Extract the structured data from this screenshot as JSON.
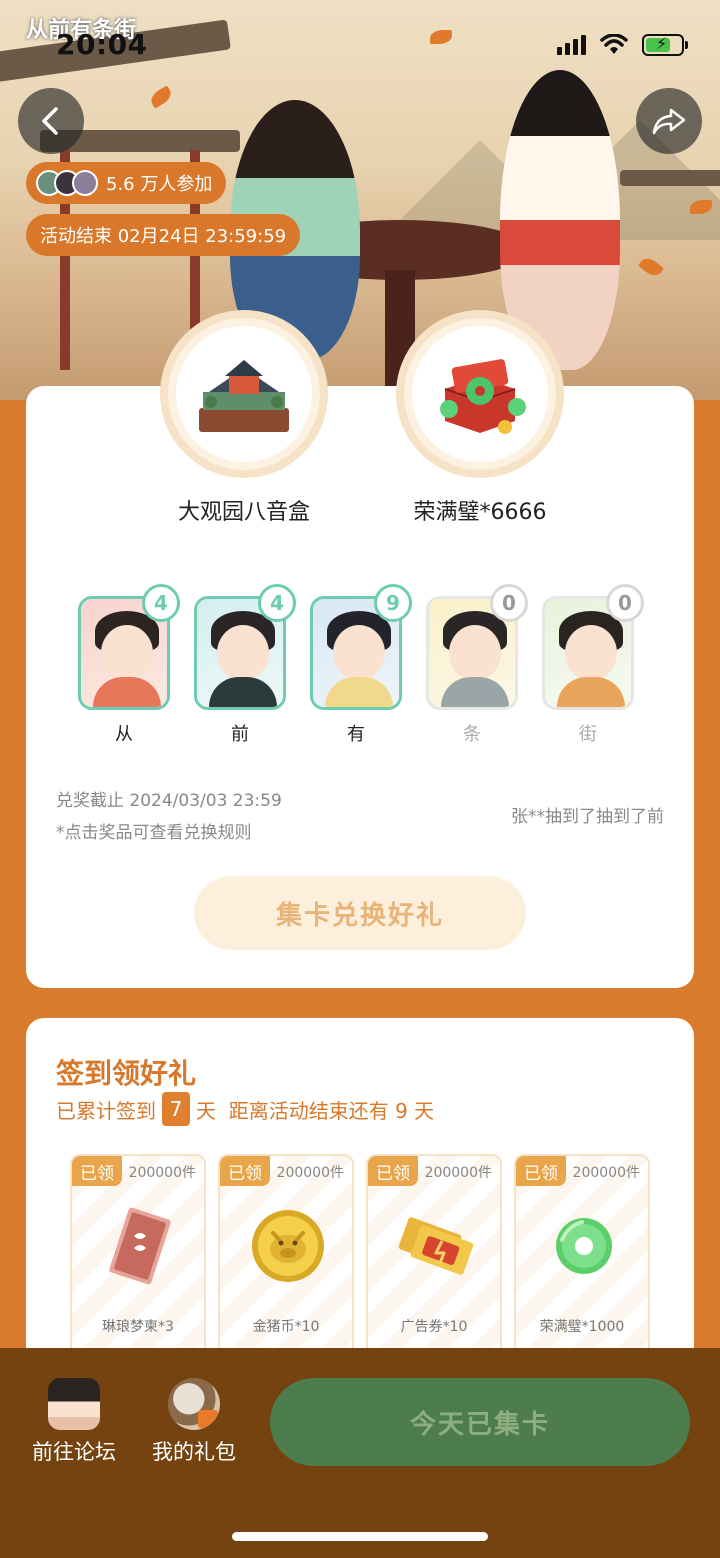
{
  "status_bar": {
    "time": "20:04"
  },
  "brand": {
    "logo_text": "从前有条街"
  },
  "header": {
    "participants": "5.6 万人参加",
    "end_time": "活动结束 02月24日 23:59:59"
  },
  "prizes": [
    {
      "name": "大观园八音盒",
      "icon": "music-box-icon"
    },
    {
      "name": "荣满璧*6666",
      "icon": "jade-gift-icon"
    }
  ],
  "cards": [
    {
      "label": "从",
      "count": "4",
      "collected": true
    },
    {
      "label": "前",
      "count": "4",
      "collected": true
    },
    {
      "label": "有",
      "count": "9",
      "collected": true
    },
    {
      "label": "条",
      "count": "0",
      "collected": false
    },
    {
      "label": "街",
      "count": "0",
      "collected": false
    }
  ],
  "redeem": {
    "deadline": "兑奖截止 2024/03/03 23:59",
    "rule_note": "*点击奖品可查看兑换规则",
    "winner_ticker": "张**抽到了抽到了前",
    "exchange_button": "集卡兑换好礼"
  },
  "signin": {
    "title": "签到领好礼",
    "prefix": "已累计签到",
    "days": "7",
    "suffix": "天  距离活动结束还有 9 天",
    "rewards": [
      {
        "tag": "已领",
        "qty": "200000件",
        "name": "琳琅梦柬*3",
        "icon": "letter-icon"
      },
      {
        "tag": "已领",
        "qty": "200000件",
        "name": "金猪币*10",
        "icon": "gold-pig-coin-icon"
      },
      {
        "tag": "已领",
        "qty": "200000件",
        "name": "广告券*10",
        "icon": "ad-ticket-icon"
      },
      {
        "tag": "已领",
        "qty": "200000件",
        "name": "荣满璧*1000",
        "icon": "jade-ring-icon"
      }
    ]
  },
  "bottom_bar": {
    "forum_label": "前往论坛",
    "gift_label": "我的礼包",
    "collect_button": "今天已集卡"
  },
  "colors": {
    "accent": "#d8782a",
    "teal": "#6ecdb1",
    "bottom_bar": "#74430f",
    "collect_button": "#4d7d4d"
  }
}
